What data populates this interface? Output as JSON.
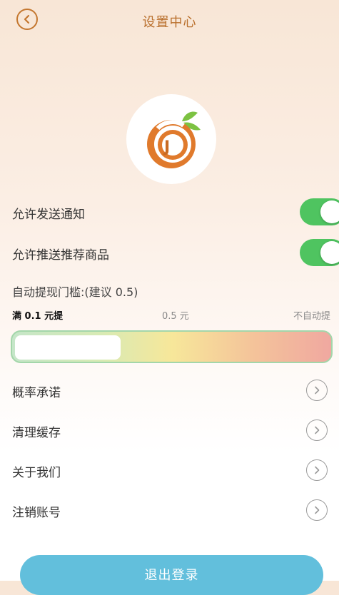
{
  "header": {
    "title": "设置中心",
    "back_icon": "chevron-left-circle-icon",
    "accent": "#c4772f"
  },
  "logo": {
    "letter": "J",
    "icon": "orange-logo-icon"
  },
  "toggles": [
    {
      "label": "允许发送通知",
      "on": true
    },
    {
      "label": "允许推送推荐商品",
      "on": true
    }
  ],
  "threshold": {
    "title": "自动提现门槛:(建议 0.5)",
    "scale_left": "满 0.1 元提",
    "scale_mid": "0.5 元",
    "scale_right": "不自动提"
  },
  "menu": [
    {
      "label": "概率承诺",
      "icon": "chevron-right-circle-icon"
    },
    {
      "label": "清理缓存",
      "icon": "chevron-right-circle-icon"
    },
    {
      "label": "关于我们",
      "icon": "chevron-right-circle-icon"
    },
    {
      "label": "注销账号",
      "icon": "chevron-right-circle-icon"
    }
  ],
  "logout": {
    "label": "退出登录",
    "color": "#62bfdc"
  },
  "colors": {
    "toggle_on": "#4fc460",
    "title": "#b96f2c"
  }
}
